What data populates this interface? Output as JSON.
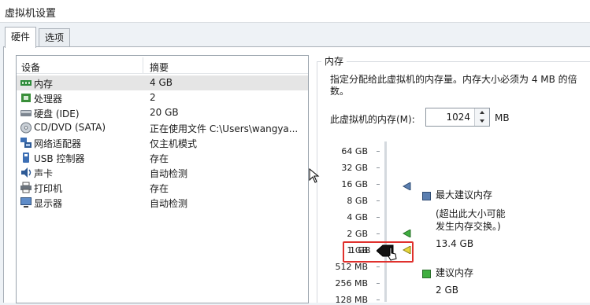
{
  "window": {
    "title": "虚拟机设置"
  },
  "tabs": [
    {
      "label": "硬件"
    },
    {
      "label": "选项"
    }
  ],
  "device_list": {
    "col_device": "设备",
    "col_summary": "摘要",
    "rows": [
      {
        "device": "内存",
        "summary": "4 GB",
        "icon": "memory-icon"
      },
      {
        "device": "处理器",
        "summary": "2",
        "icon": "processor-icon"
      },
      {
        "device": "硬盘 (IDE)",
        "summary": "20 GB",
        "icon": "hard-disk-icon"
      },
      {
        "device": "CD/DVD (SATA)",
        "summary": "正在使用文件 C:\\Users\\wangya...",
        "icon": "cd-dvd-icon"
      },
      {
        "device": "网络适配器",
        "summary": "仅主机模式",
        "icon": "network-adapter-icon"
      },
      {
        "device": "USB 控制器",
        "summary": "存在",
        "icon": "usb-icon"
      },
      {
        "device": "声卡",
        "summary": "自动检测",
        "icon": "sound-card-icon"
      },
      {
        "device": "打印机",
        "summary": "存在",
        "icon": "printer-icon"
      },
      {
        "device": "显示器",
        "summary": "自动检测",
        "icon": "display-icon"
      }
    ]
  },
  "memory": {
    "group_title": "内存",
    "description": "指定分配给此虚拟机的内存量。内存大小必须为 4 MB 的倍数。",
    "field_label": "此虚拟机的内存(M):",
    "value": "1024",
    "unit": "MB",
    "scale_labels": [
      "64 GB",
      "32 GB",
      "16 GB",
      "8 GB",
      "4 GB",
      "2 GB",
      "1 GB",
      "512 MB",
      "256 MB",
      "128 MB"
    ],
    "max_recommended": {
      "title": "最大建议内存",
      "note_line1": "(超出此大小可能",
      "note_line2": "发生内存交换。)",
      "value": "13.4 GB",
      "color": "#5b7fb0"
    },
    "recommended": {
      "title": "建议内存",
      "value": "2 GB",
      "color": "#3fae3f"
    },
    "guest_color": "#e6d63a"
  }
}
